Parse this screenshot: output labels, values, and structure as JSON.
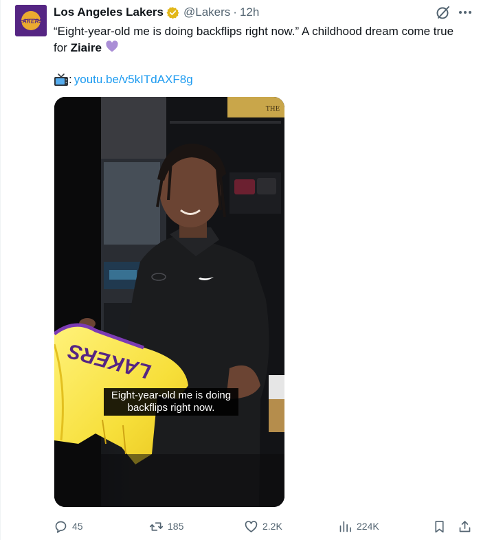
{
  "author": {
    "display_name": "Los Angeles Lakers",
    "handle": "@Lakers",
    "separator": "·",
    "time": "12h",
    "logo_text": "LAKERS",
    "brand_purple": "#552583",
    "brand_gold": "#FDB927"
  },
  "tweet": {
    "text_part1": "“Eight-year-old me is doing backflips right now.” A childhood dream come true for ",
    "bold_name": "Ziaire",
    "link_prefix": ":",
    "link_text": "youtu.be/v5kITdAXF8g"
  },
  "media": {
    "caption_line1": "Eight-year-old me is doing",
    "caption_line2": "backflips right now.",
    "jersey_text": "LAKERS",
    "sign_text": "THE"
  },
  "actions": {
    "replies": "45",
    "reposts": "185",
    "likes": "2.2K",
    "views": "224K"
  },
  "icons": {
    "verified": "verified-badge-icon",
    "grok": "grok-icon",
    "more": "more-icon",
    "tv": "tv-emoji-icon",
    "heart": "purple-heart-emoji",
    "reply": "reply-icon",
    "repost": "repost-icon",
    "like": "like-icon",
    "views": "views-icon",
    "bookmark": "bookmark-icon",
    "share": "share-icon"
  },
  "colors": {
    "text": "#0f1419",
    "secondary": "#536471",
    "link": "#1d9bf0",
    "verified": "#e2b719"
  }
}
